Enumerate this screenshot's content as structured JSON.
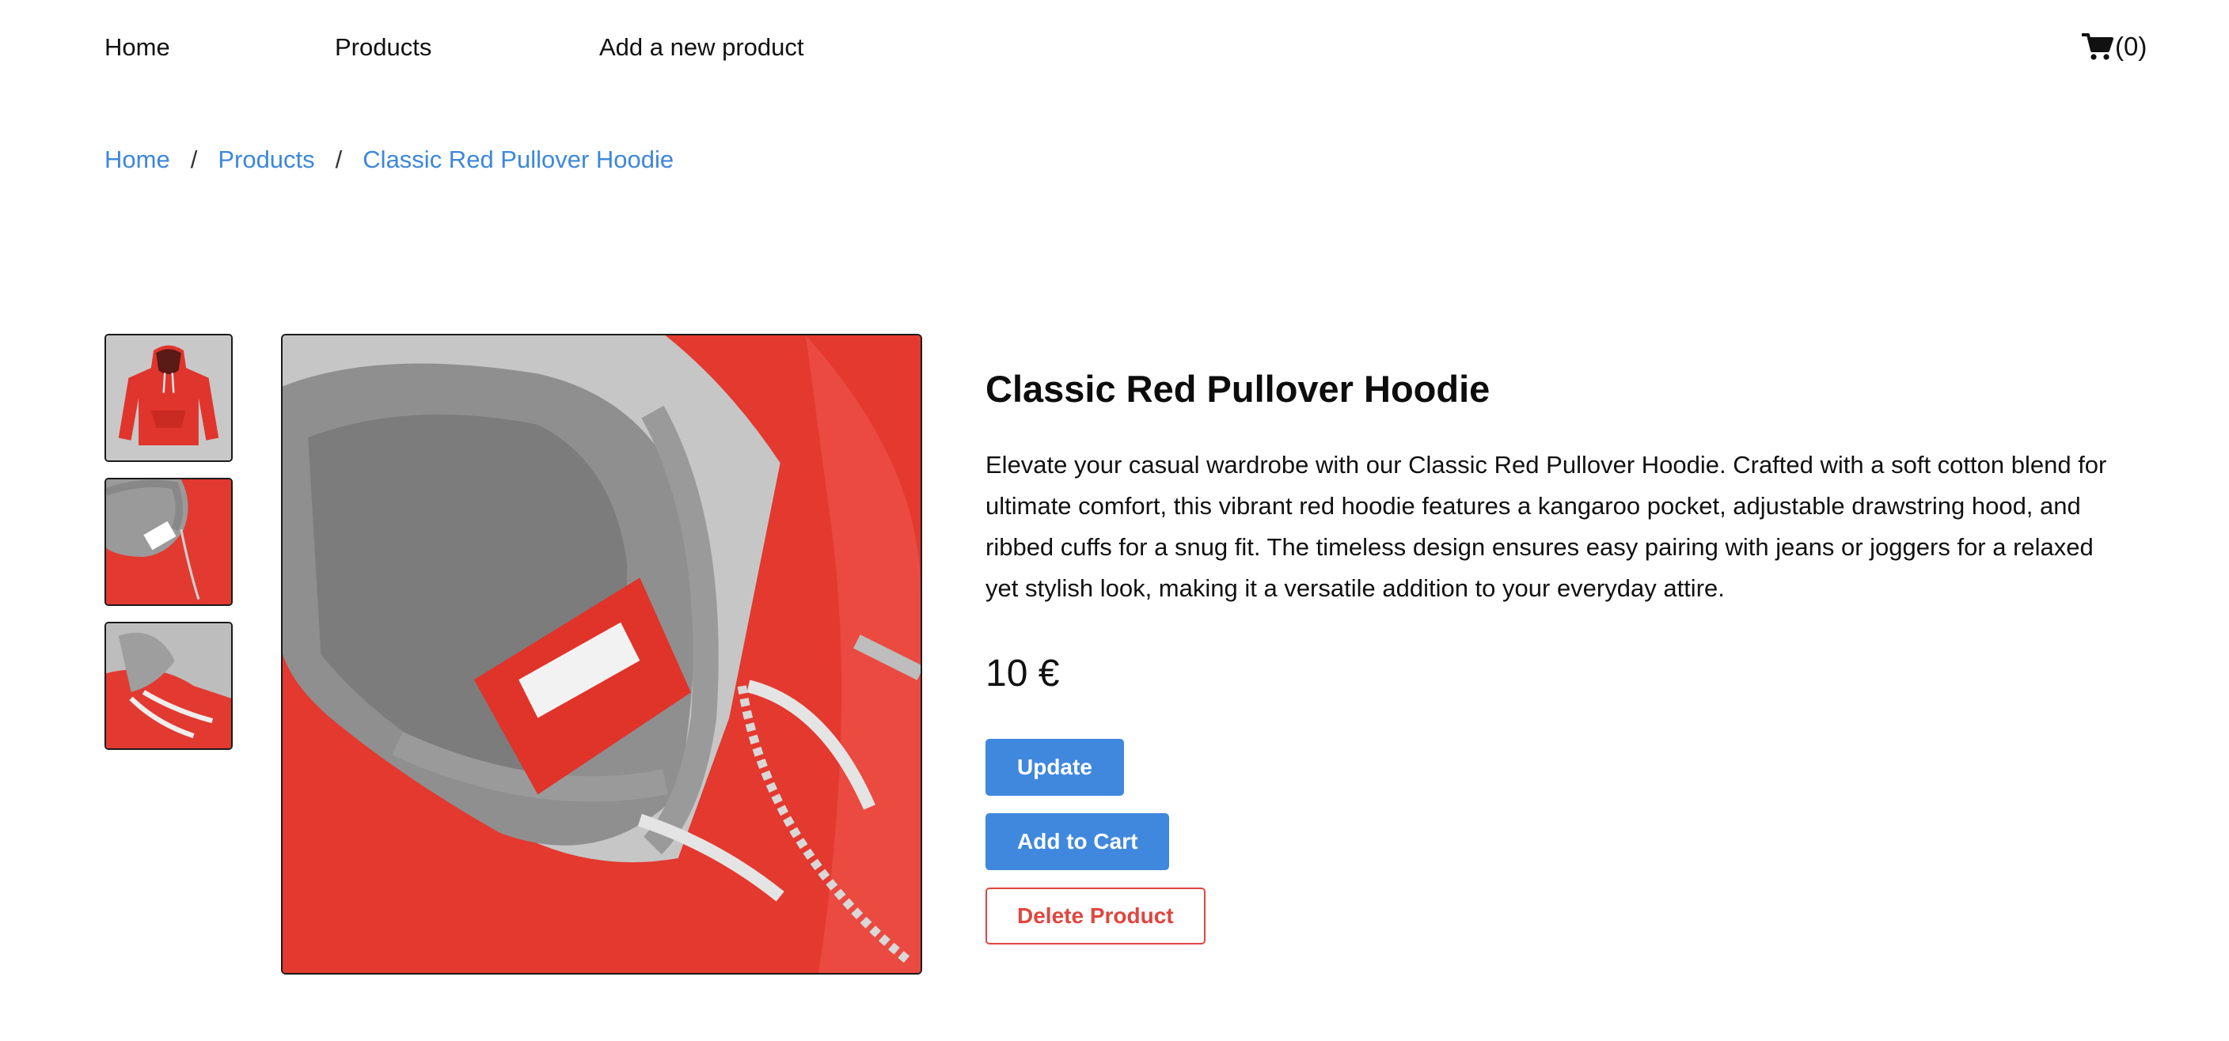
{
  "nav": {
    "home": "Home",
    "products": "Products",
    "add_product": "Add a new product",
    "cart_icon": "shopping-cart-icon",
    "cart_count": "(0)"
  },
  "breadcrumb": {
    "items": [
      "Home",
      "Products",
      "Classic Red Pullover Hoodie"
    ],
    "separator": "/"
  },
  "gallery": {
    "thumbnails": [
      {
        "label": "front view of hoodie"
      },
      {
        "label": "hood close-up"
      },
      {
        "label": "drawstrings close-up"
      }
    ],
    "selected_index": 1
  },
  "product": {
    "title": "Classic Red Pullover Hoodie",
    "description": "Elevate your casual wardrobe with our Classic Red Pullover Hoodie. Crafted with a soft cotton blend for ultimate comfort, this vibrant red hoodie features a kangaroo pocket, adjustable drawstring hood, and ribbed cuffs for a snug fit. The timeless design ensures easy pairing with jeans or joggers for a relaxed yet stylish look, making it a versatile addition to your everyday attire.",
    "price": "10 €"
  },
  "actions": {
    "update": "Update",
    "add_to_cart": "Add to Cart",
    "delete": "Delete Product"
  },
  "colors": {
    "link": "#3d87db",
    "primary": "#3f88de",
    "danger": "#e0453f",
    "product_red": "#e2382f"
  }
}
